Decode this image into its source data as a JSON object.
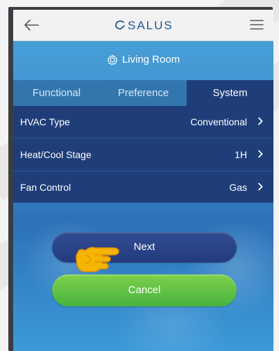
{
  "app": {
    "brand": "SALUS",
    "room_name": "Living Room"
  },
  "tabs": [
    {
      "label": "Functional",
      "active": false
    },
    {
      "label": "Preference",
      "active": false
    },
    {
      "label": "System",
      "active": true
    }
  ],
  "settings": [
    {
      "label": "HVAC Type",
      "value": "Conventional"
    },
    {
      "label": "Heat/Cool Stage",
      "value": "1H"
    },
    {
      "label": "Fan Control",
      "value": "Gas"
    }
  ],
  "buttons": {
    "next": "Next",
    "cancel": "Cancel"
  },
  "icons": {
    "back": "back-arrow-icon",
    "menu": "menu-icon",
    "room": "gear-icon",
    "row_chevron": "chevron-right-icon",
    "pointer": "pointer-hand-icon"
  },
  "colors": {
    "brand_blue": "#21598f",
    "tab_active": "#1f3e79",
    "row_background": "#1f3e79",
    "next_button": "#233b7e",
    "cancel_button": "#48b341",
    "pointer_hand": "#f4b400"
  }
}
